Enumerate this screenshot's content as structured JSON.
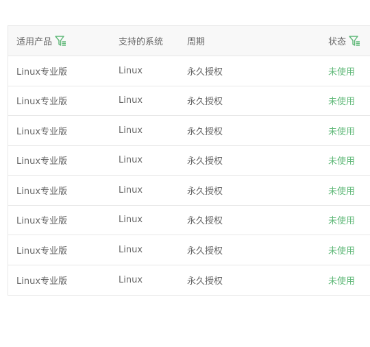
{
  "table": {
    "columns": [
      {
        "label": "适用产品",
        "filter_icon": "filter-icon"
      },
      {
        "label": "支持的系统"
      },
      {
        "label": "周期"
      },
      {
        "label": "状态",
        "filter_icon": "filter-icon"
      }
    ],
    "rows": [
      {
        "product": "Linux专业版",
        "system": "Linux",
        "period": "永久授权",
        "status": "未使用"
      },
      {
        "product": "Linux专业版",
        "system": "Linux",
        "period": "永久授权",
        "status": "未使用"
      },
      {
        "product": "Linux专业版",
        "system": "Linux",
        "period": "永久授权",
        "status": "未使用"
      },
      {
        "product": "Linux专业版",
        "system": "Linux",
        "period": "永久授权",
        "status": "未使用"
      },
      {
        "product": "Linux专业版",
        "system": "Linux",
        "period": "永久授权",
        "status": "未使用"
      },
      {
        "product": "Linux专业版",
        "system": "Linux",
        "period": "永久授权",
        "status": "未使用"
      },
      {
        "product": "Linux专业版",
        "system": "Linux",
        "period": "永久授权",
        "status": "未使用"
      },
      {
        "product": "Linux专业版",
        "system": "Linux",
        "period": "永久授权",
        "status": "未使用"
      }
    ]
  },
  "colors": {
    "accent": "#5fb878",
    "border": "#e6e6e6",
    "header_bg": "#f8f8f8",
    "text": "#666666"
  }
}
